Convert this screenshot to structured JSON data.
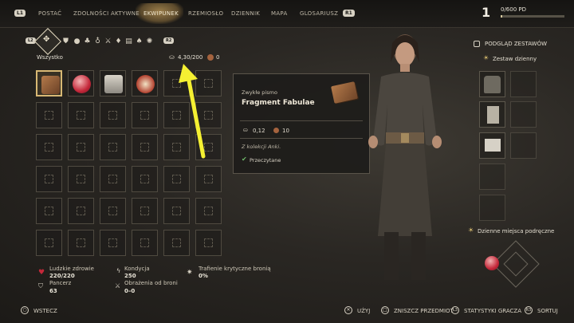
{
  "nav": {
    "left_hint": "L1",
    "right_hint": "R1",
    "tabs": [
      "POSTAĆ",
      "ZDOLNOŚCI AKTYWNE",
      "EKWIPUNEK",
      "RZEMIOSŁO",
      "DZIENNIK",
      "MAPA",
      "GLOSARIUSZ"
    ],
    "level": "1",
    "xp": "0/600 PD",
    "xp_progress": 0.02
  },
  "filters": {
    "left_hint": "L2",
    "right_hint": "R2",
    "icons": [
      "all-icon",
      "armor-icon",
      "apple-icon",
      "potion-icon",
      "pouch-icon",
      "sword-icon",
      "book-icon",
      "plant-icon",
      "gear-icon"
    ],
    "category": "Wszystko",
    "weight": "4,30/200",
    "money": "0"
  },
  "tooltip": {
    "subtitle": "Zwykłe pismo",
    "title": "Fragment Fabulae",
    "weight": "0,12",
    "price": "10",
    "collection": "Z kolekcji Anki.",
    "status": "Przeczytane"
  },
  "stats": {
    "health_label": "Ludzkie zdrowie",
    "health_value": "220/220",
    "armor_label": "Pancerz",
    "armor_value": "63",
    "stamina_label": "Kondycja",
    "stamina_value": "250",
    "damage_label": "Obrażenia od broni",
    "damage_value": "0–0",
    "crit_label": "Trafienie krytyczne bronią",
    "crit_value": "0%"
  },
  "right_panel": {
    "preview": "PODGLĄD ZESTAWÓW",
    "set": "Zestaw dzienny",
    "quick": "Dzienne miejsca podręczne"
  },
  "bottom": {
    "back": "WSTECZ",
    "use": "UŻYJ",
    "destroy": "ZNISZCZ PRZEDMIOT",
    "player_stats": "STATYSTYKI GRACZA",
    "sort": "SORTUJ",
    "destroy_hint": "□",
    "stats_hint": "L3",
    "sort_hint": "R3"
  },
  "colors": {
    "accent": "#d8b874",
    "arrow": "#f5f032"
  }
}
